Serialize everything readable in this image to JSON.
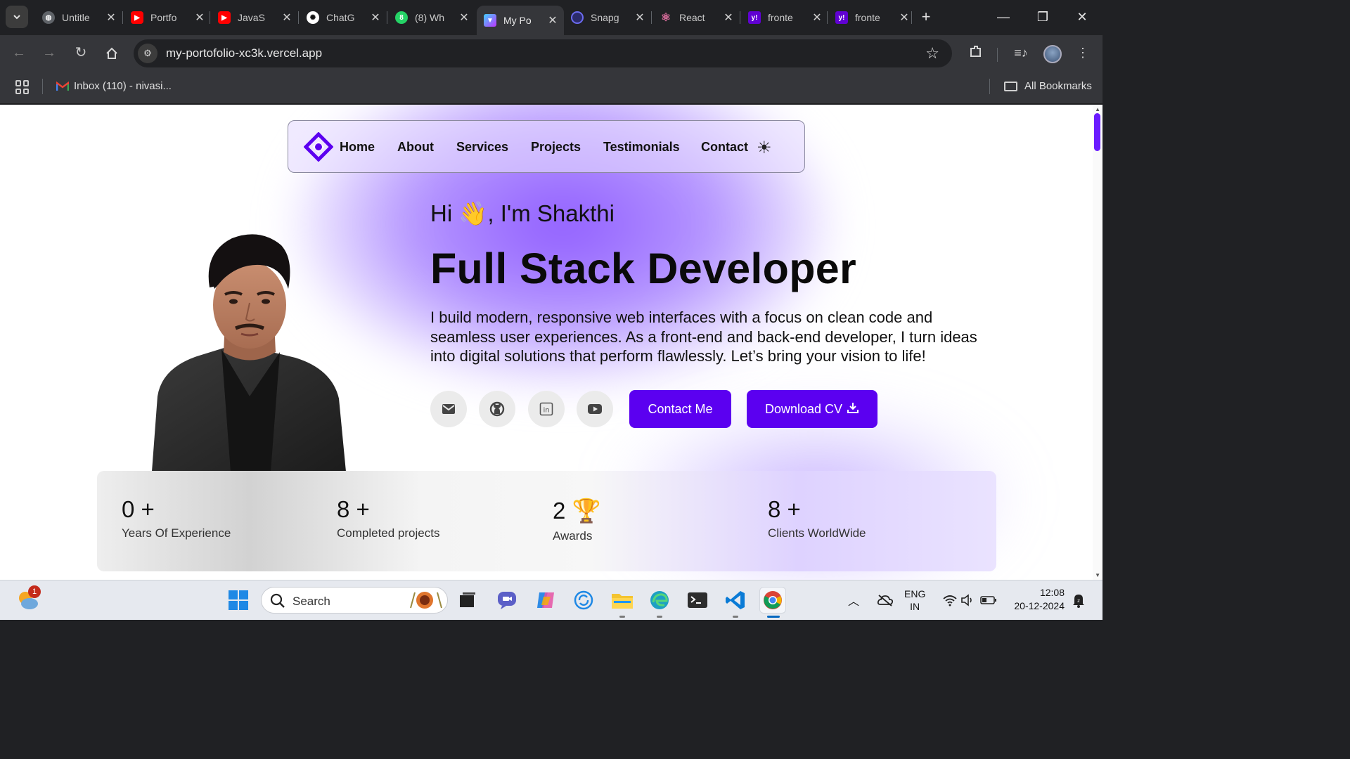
{
  "browser": {
    "tabs": [
      {
        "title": "Untitle",
        "favicon_color": "#5f6368"
      },
      {
        "title": "Portfo",
        "favicon_color": "#ff0000"
      },
      {
        "title": "JavaS",
        "favicon_color": "#ff0000"
      },
      {
        "title": "ChatG",
        "favicon_color": "#ffffff"
      },
      {
        "title": "(8) Wh",
        "favicon_color": "#25d366"
      },
      {
        "title": "My Po",
        "favicon_color": "#8b5cf6"
      },
      {
        "title": "Snapg",
        "favicon_color": "#5b5bd6"
      },
      {
        "title": "React",
        "favicon_color": "#e06fa0"
      },
      {
        "title": "fronte",
        "favicon_color": "#6001d2"
      },
      {
        "title": "fronte",
        "favicon_color": "#6001d2"
      }
    ],
    "active_tab_index": 5,
    "url": "my-portofolio-xc3k.vercel.app",
    "bookmarks": {
      "gmail_label": "Inbox (110) - nivasi...",
      "all_bookmarks_label": "All Bookmarks"
    }
  },
  "site": {
    "nav": [
      "Home",
      "About",
      "Services",
      "Projects",
      "Testimonials",
      "Contact"
    ],
    "theme_icon": "sun-icon",
    "greeting": "Hi 👋, I'm Shakthi",
    "headline": "Full Stack Developer",
    "bio": "I build modern, responsive web interfaces with a focus on clean code and seamless user experiences. As a front-end and back-end developer, I turn ideas into digital solutions that perform flawlessly. Let’s bring your vision to life!",
    "social_icons": [
      "mail-icon",
      "github-icon",
      "linkedin-icon",
      "youtube-icon"
    ],
    "contact_button": "Contact Me",
    "download_button": "Download CV",
    "stats": [
      {
        "value": "0 +",
        "label": "Years Of Experience"
      },
      {
        "value": "8 +",
        "label": "Completed projects"
      },
      {
        "value": "2 🏆",
        "label": "Awards"
      },
      {
        "value": "8 +",
        "label": "Clients WorldWide"
      }
    ],
    "accent_color": "#5b00f0"
  },
  "taskbar": {
    "search_label": "Search",
    "language": "ENG",
    "region": "IN",
    "time": "12:08",
    "date": "20-12-2024",
    "weather_badge": "1"
  }
}
